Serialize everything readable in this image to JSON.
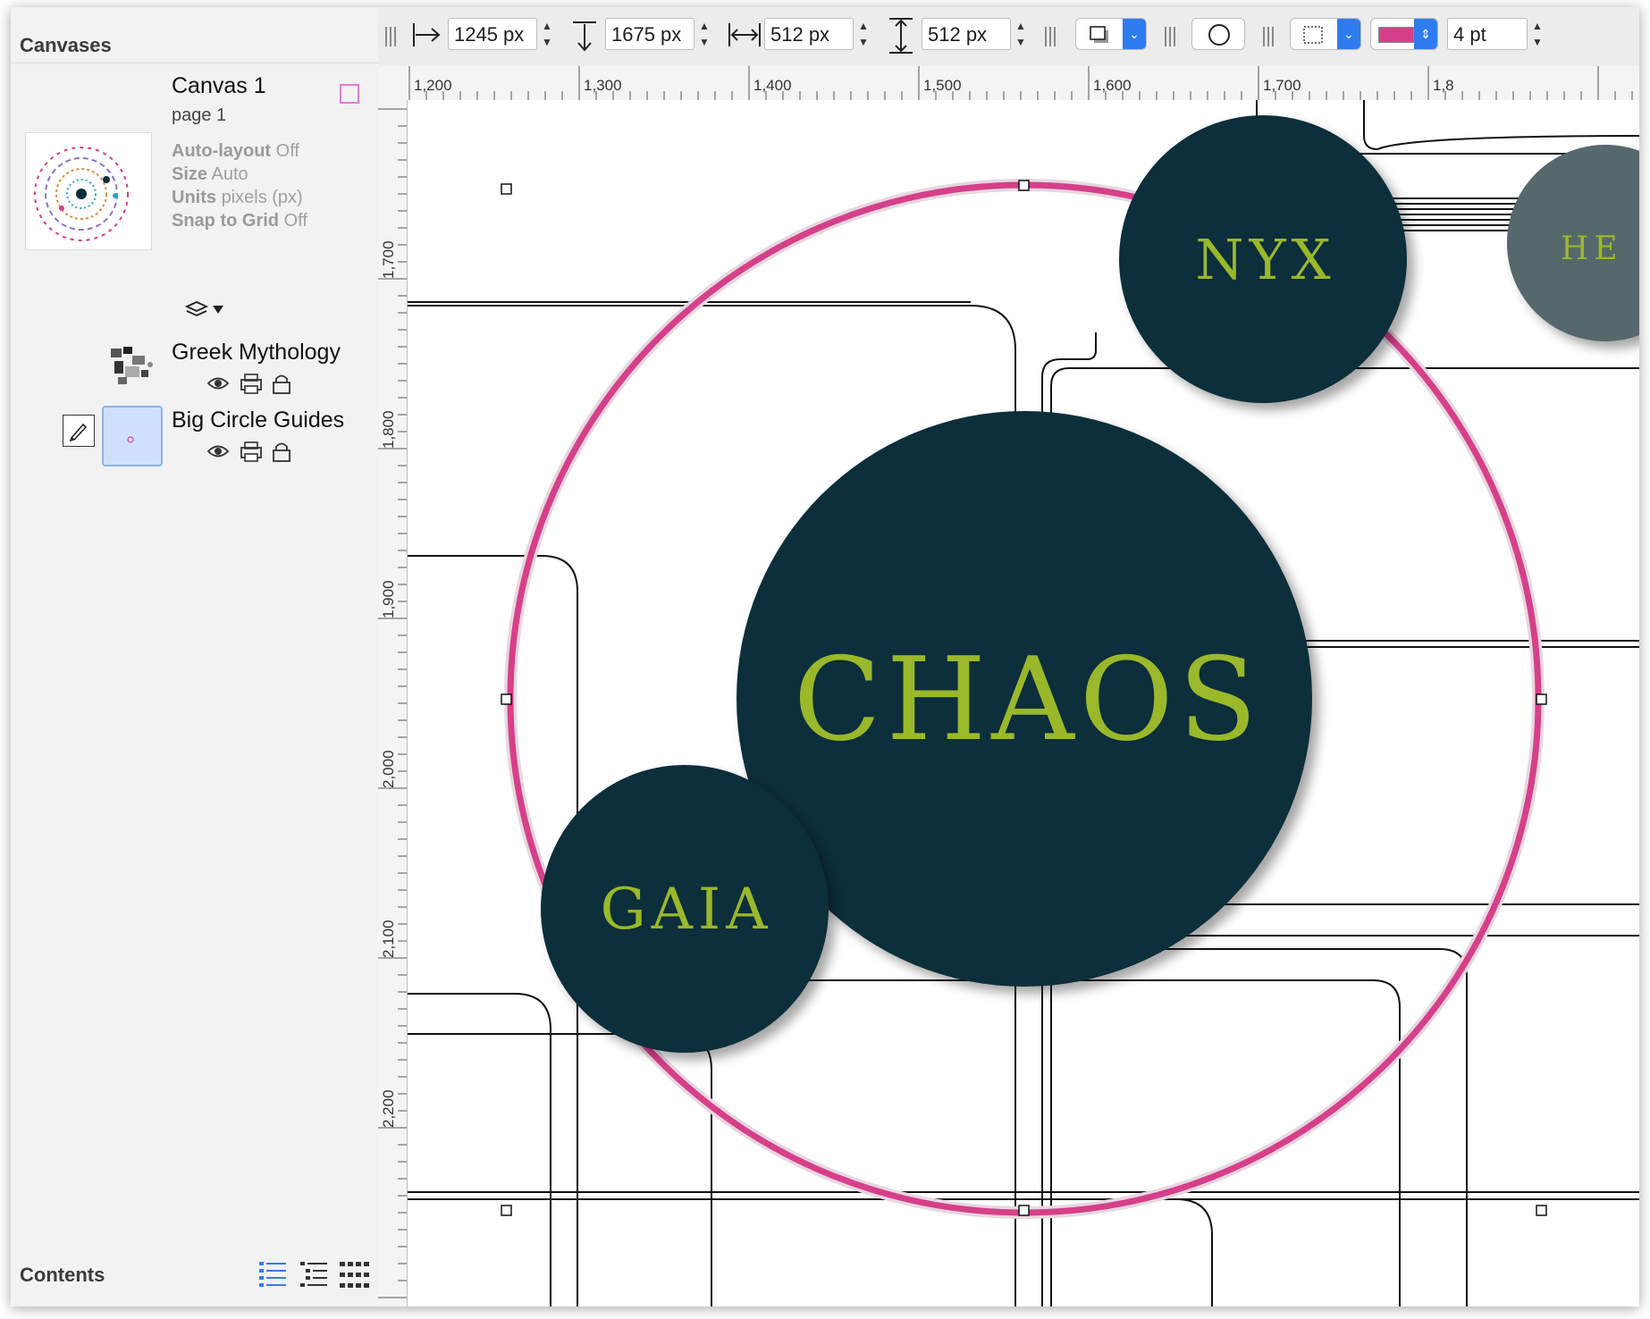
{
  "sidebar": {
    "header": "Canvases",
    "canvas": {
      "title": "Canvas 1",
      "subtitle": "page 1"
    },
    "properties": [
      {
        "key": "Auto-layout",
        "value": "Off"
      },
      {
        "key": "Size",
        "value": "Auto"
      },
      {
        "key": "Units",
        "value": "pixels (px)"
      },
      {
        "key": "Snap to Grid",
        "value": "Off"
      }
    ],
    "layers": [
      {
        "name": "Greek Mythology"
      },
      {
        "name": "Big Circle Guides"
      }
    ],
    "footer": "Contents"
  },
  "toolbar": {
    "x": "1245 px",
    "y": "1675 px",
    "width": "512 px",
    "height": "512 px",
    "stroke_width": "4 pt",
    "stroke_color": "#d63f8a"
  },
  "rulers": {
    "h": [
      "1,200",
      "1,300",
      "1,400",
      "1,500",
      "1,600",
      "1,700",
      "1,8"
    ],
    "v": [
      "1,700",
      "1,800",
      "1,900",
      "2,000",
      "2,100",
      "2,200"
    ]
  },
  "canvas": {
    "nodes": [
      {
        "label": "CHAOS"
      },
      {
        "label": "NYX"
      },
      {
        "label": "GAIA"
      },
      {
        "label": "HE"
      }
    ],
    "guide_color": "#d63f8a",
    "node_color": "#0b2d3a",
    "text_color": "#9ab82a"
  }
}
